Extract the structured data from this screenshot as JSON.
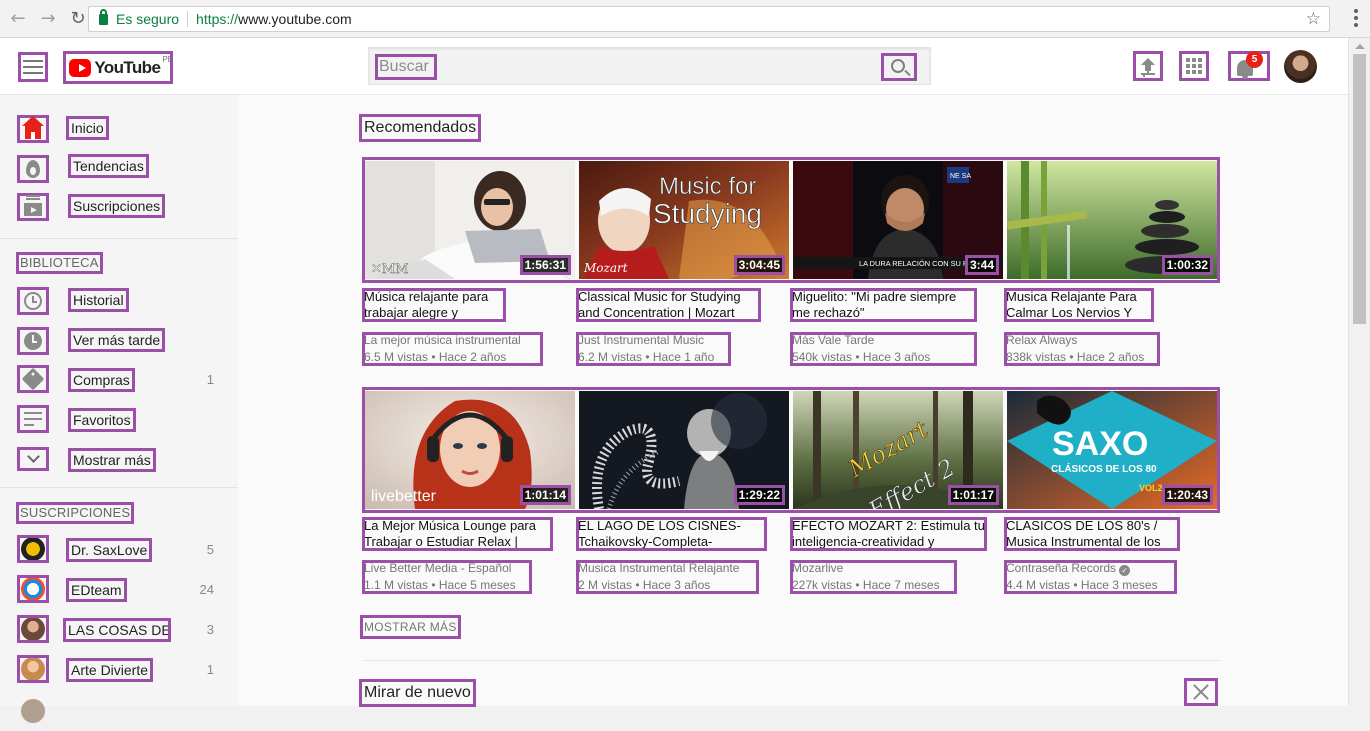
{
  "browser": {
    "secure_label": "Es seguro",
    "url_scheme": "https://",
    "url_host": "www.youtube.com"
  },
  "header": {
    "logo_text": "YouTube",
    "country": "PE",
    "search_placeholder": "Buscar",
    "notification_count": "5"
  },
  "sidebar": {
    "nav": [
      {
        "label": "Inicio",
        "icon": "home-icon"
      },
      {
        "label": "Tendencias",
        "icon": "trending-icon"
      },
      {
        "label": "Suscripciones",
        "icon": "subscriptions-icon"
      }
    ],
    "library_heading": "BIBLIOTECA",
    "library": [
      {
        "label": "Historial",
        "icon": "history-icon",
        "count": ""
      },
      {
        "label": "Ver más tarde",
        "icon": "watch-later-icon",
        "count": ""
      },
      {
        "label": "Compras",
        "icon": "tag-icon",
        "count": "1"
      },
      {
        "label": "Favoritos",
        "icon": "playlist-icon",
        "count": ""
      },
      {
        "label": "Mostrar más",
        "icon": "chevron-down-icon",
        "count": ""
      }
    ],
    "subs_heading": "SUSCRIPCIONES",
    "subscriptions": [
      {
        "label": "Dr. SaxLove",
        "count": "5"
      },
      {
        "label": "EDteam",
        "count": "24"
      },
      {
        "label": "LAS COSAS DE ...",
        "count": "3"
      },
      {
        "label": "Arte Divierte",
        "count": "1"
      }
    ]
  },
  "main": {
    "shelf_title": "Recomendados",
    "videos_row1": [
      {
        "title": "Música relajante para trabajar alegre y",
        "channel": "La mejor música instrumental",
        "stats": "6.5 M vistas • Hace 2 años",
        "duration": "1:56:31"
      },
      {
        "title": "Classical Music for Studying and Concentration | Mozart",
        "channel": "Just Instrumental Music",
        "stats": "6.2 M vistas • Hace 1 año",
        "duration": "3:04:45"
      },
      {
        "title": "Miguelito: \"Mi padre siempre me rechazó\"",
        "channel": "Más Vale Tarde",
        "stats": "540k vistas • Hace 3 años",
        "duration": "3:44"
      },
      {
        "title": "Musica Relajante Para Calmar Los Nervios Y",
        "channel": "Relax Always",
        "stats": "838k vistas • Hace 2 años",
        "duration": "1:00:32"
      }
    ],
    "videos_row2": [
      {
        "title": "La Mejor Música Lounge para Trabajar o Estudiar Relax |",
        "channel": "Live Better Media - Español",
        "stats": "1.1 M vistas • Hace 5 meses",
        "duration": "1:01:14"
      },
      {
        "title": "EL LAGO DE LOS CISNES-Tchaikovsky-Completa-",
        "channel": "Musica Instrumental Relajante",
        "stats": "2 M vistas • Hace 3 años",
        "duration": "1:29:22"
      },
      {
        "title": "EFECTO MOZART 2: Estimula tu inteligencia-creatividad y",
        "channel": "Mozarlive",
        "stats": "227k vistas • Hace 7 meses",
        "duration": "1:01:17"
      },
      {
        "title": "CLASICOS DE LOS 80's / Musica Instrumental de los",
        "channel": "Contraseña Records",
        "stats": "4.4 M vistas • Hace 3 meses",
        "duration": "1:20:43"
      }
    ],
    "thumb_text": {
      "mozart_title_line1": "Music for",
      "mozart_title_line2": "Studying",
      "mozart_sign": "Mozart",
      "news_ticker": "LA DURA RELACIÓN CON SU PADRE",
      "livebetter": "livebetter",
      "effect_line1": "Mozart",
      "effect_line2": "Effect 2",
      "saxo_title": "SAXO",
      "saxo_sub": "CLÁSICOS DE LOS 80",
      "saxo_vol": "VOL2"
    },
    "show_more": "MOSTRAR MÁS",
    "rewatch_title": "Mirar de nuevo"
  }
}
